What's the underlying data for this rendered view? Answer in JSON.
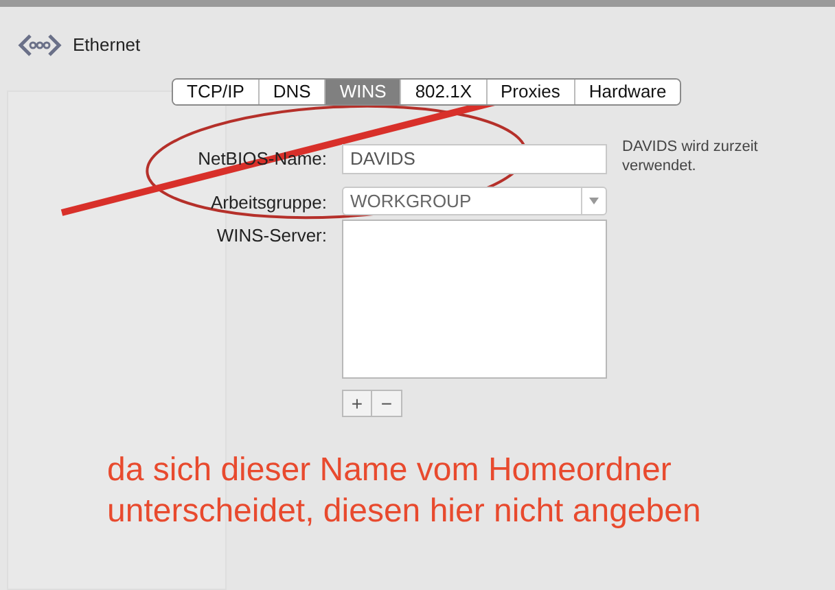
{
  "header": {
    "title": "Ethernet"
  },
  "tabs": [
    {
      "label": "TCP/IP",
      "selected": false
    },
    {
      "label": "DNS",
      "selected": false
    },
    {
      "label": "WINS",
      "selected": true
    },
    {
      "label": "802.1X",
      "selected": false
    },
    {
      "label": "Proxies",
      "selected": false
    },
    {
      "label": "Hardware",
      "selected": false
    }
  ],
  "form": {
    "netbios_label": "NetBIOS-Name:",
    "netbios_value": "DAVIDS",
    "note": "DAVIDS wird zurzeit verwendet.",
    "workgroup_label": "Arbeitsgruppe:",
    "workgroup_value": "WORKGROUP",
    "wins_label": "WINS-Server:",
    "add": "+",
    "remove": "−"
  },
  "annotation": {
    "lines": [
      "da sich dieser Name vom Homeordner",
      "unterscheidet, diesen hier nicht angeben"
    ]
  }
}
